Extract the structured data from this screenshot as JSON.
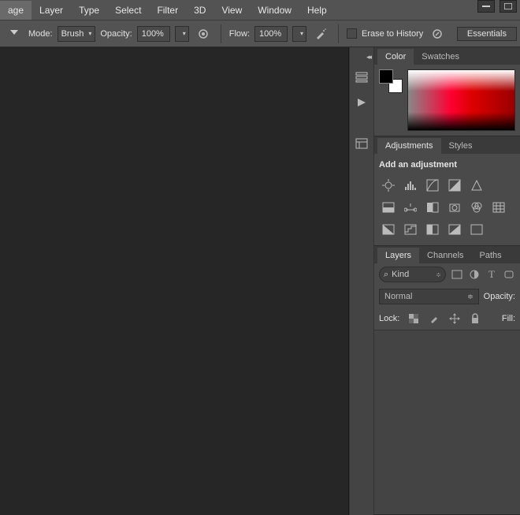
{
  "menu": [
    "age",
    "Layer",
    "Type",
    "Select",
    "Filter",
    "3D",
    "View",
    "Window",
    "Help"
  ],
  "optbar": {
    "mode_label": "Mode:",
    "mode_value": "Brush",
    "opacity_label": "Opacity:",
    "opacity_value": "100%",
    "flow_label": "Flow:",
    "flow_value": "100%",
    "erase_label": "Erase to History",
    "essentials": "Essentials"
  },
  "panels": {
    "color_tab": "Color",
    "swatches_tab": "Swatches",
    "adjustments_tab": "Adjustments",
    "styles_tab": "Styles",
    "add_adjustment": "Add an adjustment",
    "layers_tab": "Layers",
    "channels_tab": "Channels",
    "paths_tab": "Paths",
    "kind_label": "Kind",
    "blend_mode": "Normal",
    "opacity_label": "Opacity:",
    "lock_label": "Lock:",
    "fill_label": "Fill:"
  },
  "search_icon": "⌕"
}
